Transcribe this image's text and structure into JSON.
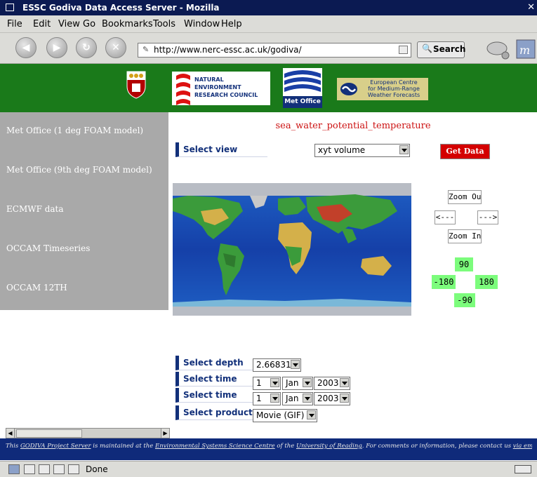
{
  "window": {
    "title": "ESSC Godiva Data Access Server - Mozilla",
    "close_glyph": "✕"
  },
  "menu": [
    "File",
    "Edit",
    "View",
    "Go",
    "Bookmarks",
    "Tools",
    "Window",
    "Help"
  ],
  "toolbar": {
    "url": "http://www.nerc-essc.ac.uk/godiva/",
    "search_label": "Search"
  },
  "banner": {
    "nerc_lines": [
      "NATURAL",
      "ENVIRONMENT",
      "RESEARCH COUNCIL"
    ],
    "metoffice": "Met Office",
    "ecmwf_lines": [
      "European Centre",
      "for Medium-Range",
      "Weather Forecasts"
    ]
  },
  "sidebar": {
    "items": [
      "Met Office (1 deg FOAM model)",
      "Met Office (9th deg FOAM model)",
      "ECMWF data",
      "OCCAM Timeseries",
      "OCCAM 12TH"
    ]
  },
  "main": {
    "variable": "sea_water_potential_temperature",
    "select_view_label": "Select view",
    "view_value": "xyt volume",
    "get_data": "Get Data",
    "zoom_out": "Zoom Out",
    "pan_left": "<---",
    "pan_right": "--->",
    "zoom_in": "Zoom In",
    "coords": {
      "north": "90",
      "south": "-90",
      "west": "-180",
      "east": "180"
    },
    "depth_label": "Select depth",
    "depth_value": "2.66831",
    "time1_label": "Select time",
    "time1": {
      "day": "1",
      "month": "Jan",
      "year": "2003"
    },
    "time2_label": "Select time",
    "time2": {
      "day": "1",
      "month": "Jan",
      "year": "2003"
    },
    "product_label": "Select product",
    "product_value": "Movie (GIF)"
  },
  "footer": {
    "pre": "This ",
    "link1": "GODIVA Project Server",
    "mid1": " is maintained at the ",
    "link2": "Environmental Systems Science Centre",
    "mid2": " of the ",
    "link3": "University of Reading",
    "mid3": ". For comments or information, please contact us ",
    "link4": "via email",
    "end": "."
  },
  "status": {
    "text": "Done"
  },
  "colors": {
    "banner": "#1a7a1a",
    "sidebar": "#a9a9a9",
    "accent_red": "#cc1111",
    "label_blue": "#12307a",
    "coord_green": "#7cfc7c",
    "footer": "#0f2a7a"
  }
}
